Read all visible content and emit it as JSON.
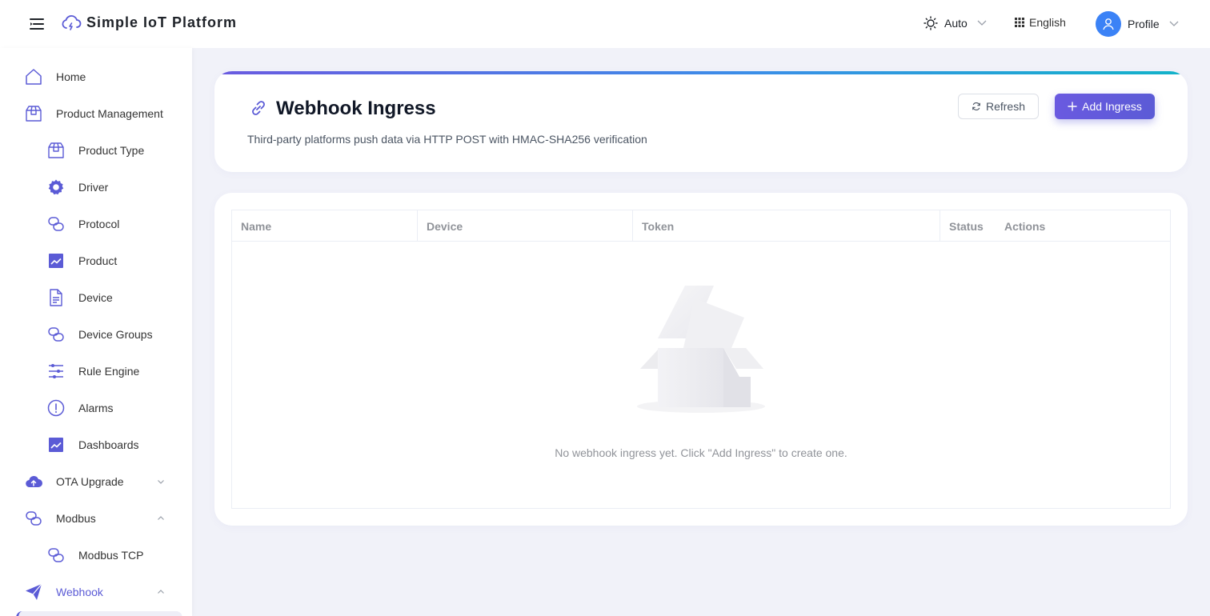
{
  "header": {
    "app_title": "Simple IoT Platform",
    "theme_label": "Auto",
    "language_label": "English",
    "profile_label": "Profile"
  },
  "sidebar": {
    "items": [
      {
        "label": "Home",
        "icon": "home-icon"
      },
      {
        "label": "Product Management",
        "icon": "box-icon"
      },
      {
        "label": "Product Type",
        "icon": "box-icon"
      },
      {
        "label": "Driver",
        "icon": "gear-icon"
      },
      {
        "label": "Protocol",
        "icon": "link-chain-icon"
      },
      {
        "label": "Product",
        "icon": "chart-icon"
      },
      {
        "label": "Device",
        "icon": "document-icon"
      },
      {
        "label": "Device Groups",
        "icon": "link-chain-icon"
      },
      {
        "label": "Rule Engine",
        "icon": "sliders-icon"
      },
      {
        "label": "Alarms",
        "icon": "alert-circle-icon"
      },
      {
        "label": "Dashboards",
        "icon": "chart-icon"
      },
      {
        "label": "OTA Upgrade",
        "icon": "cloud-upload-icon"
      },
      {
        "label": "Modbus",
        "icon": "link-chain-icon"
      },
      {
        "label": "Modbus TCP",
        "icon": "link-chain-icon"
      },
      {
        "label": "Webhook",
        "icon": "send-icon"
      }
    ]
  },
  "page": {
    "title": "Webhook Ingress",
    "description": "Third-party platforms push data via HTTP POST with HMAC-SHA256 verification",
    "refresh_label": "Refresh",
    "add_label": "Add Ingress"
  },
  "table": {
    "columns": [
      "Name",
      "Device",
      "Token",
      "Status",
      "Actions"
    ],
    "empty_text": "No webhook ingress yet. Click \"Add Ingress\" to create one."
  },
  "colors": {
    "accent": "#5b5bd6",
    "background": "#f1f2f9"
  }
}
